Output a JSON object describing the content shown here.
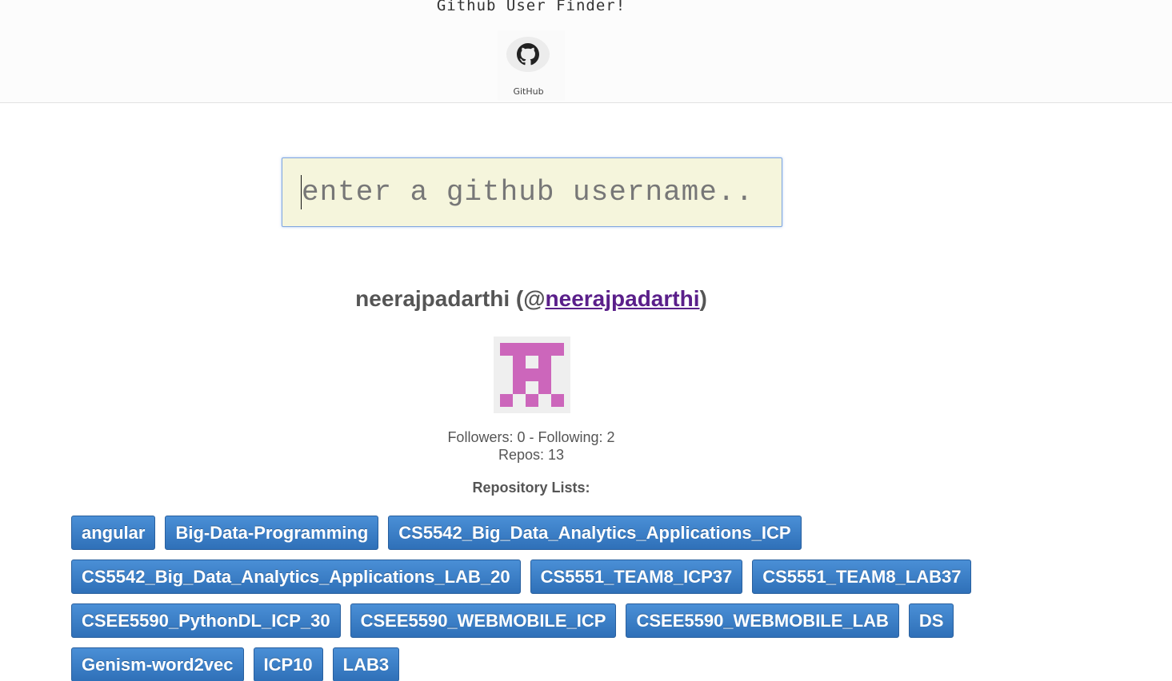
{
  "header": {
    "title": "Github User Finder!",
    "github_label": "GitHub",
    "github_icon": "github-octocat-icon"
  },
  "search": {
    "placeholder": "enter a github username..",
    "value": ""
  },
  "user": {
    "display_name": "neerajpadarthi",
    "at_prefix": " (@",
    "login": "neerajpadarthi",
    "suffix": ")",
    "avatar_color": "#cc66bb",
    "followers_label": "Followers: ",
    "followers": "0",
    "following_label": " - Following: ",
    "following": "2",
    "repos_label": "Repos: ",
    "repos": "13"
  },
  "repositories": {
    "heading": "Repository Lists:",
    "items": [
      "angular",
      "Big-Data-Programming",
      "CS5542_Big_Data_Analytics_Applications_ICP",
      "CS5542_Big_Data_Analytics_Applications_LAB_20",
      "CS5551_TEAM8_ICP37",
      "CS5551_TEAM8_LAB37",
      "CSEE5590_PythonDL_ICP_30",
      "CSEE5590_WEBMOBILE_ICP",
      "CSEE5590_WEBMOBILE_LAB",
      "DS",
      "Genism-word2vec",
      "ICP10",
      "LAB3"
    ]
  },
  "colors": {
    "button": "#337ab7",
    "link": "#5a1f8a",
    "input_bg": "#f5f5dc"
  }
}
